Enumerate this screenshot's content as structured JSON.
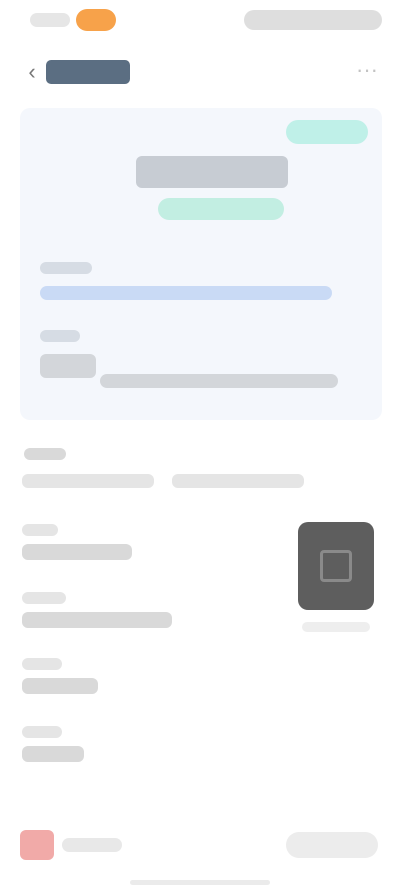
{
  "status_bar": {
    "time": "",
    "pill": "",
    "right": ""
  },
  "nav": {
    "back_icon": "chevron-left-icon",
    "title": "",
    "more_icon": "more-icon"
  },
  "card": {
    "tag": "",
    "headline": "",
    "status": "",
    "rows": [
      {
        "label": "",
        "value": ""
      },
      {
        "label": "",
        "value": ""
      }
    ]
  },
  "details": {
    "section_title": "",
    "line_1": "",
    "line_2": "",
    "items": [
      {
        "label": "",
        "value": ""
      },
      {
        "label": "",
        "value": ""
      },
      {
        "label": "",
        "value": ""
      },
      {
        "label": "",
        "value": ""
      }
    ],
    "thumbnail_caption": ""
  },
  "bottom_bar": {
    "shop_label": "",
    "action_label": ""
  },
  "colors": {
    "accent_orange": "#f7a24a",
    "accent_teal": "#bff0e8",
    "title_bg": "#5b6e82",
    "card_bg": "#f4f7fc",
    "shop_red": "#f1aaa8"
  }
}
